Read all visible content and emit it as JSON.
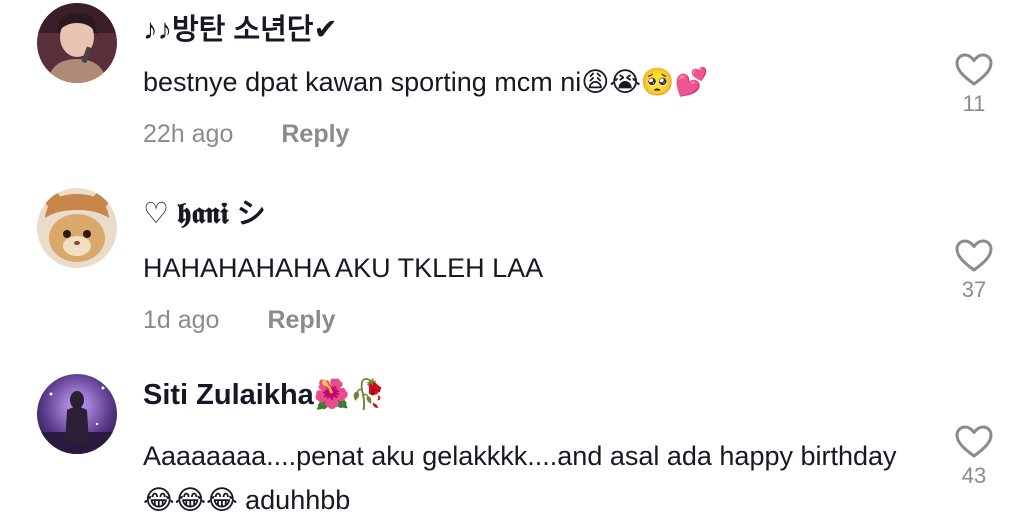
{
  "comments": [
    {
      "username": "♪♪방탄 소년단✔",
      "text": "bestnye dpat kawan sporting mcm ni😩😭🥺💕",
      "time": "22h ago",
      "reply_label": "Reply",
      "likes": "11",
      "avatar_icon": "avatar-photo-person"
    },
    {
      "username": "♡ 𝖍𝖆𝖓𝖎 シ",
      "text": "HAHAHAHAHA AKU TKLEH LAA",
      "time": "1d ago",
      "reply_label": "Reply",
      "likes": "37",
      "avatar_icon": "avatar-photo-cat"
    },
    {
      "username": "Siti Zulaikha🌺🥀",
      "text": "Aaaaaaaa....penat aku gelakkkk....and asal ada happy birthday😂😂😂 aduhhbb",
      "time": "",
      "reply_label": "",
      "likes": "43",
      "avatar_icon": "avatar-photo-figure"
    }
  ],
  "colors": {
    "text": "#161823",
    "muted": "#8a8b91",
    "background": "#ffffff"
  },
  "icons": {
    "like": "heart-outline-icon"
  }
}
